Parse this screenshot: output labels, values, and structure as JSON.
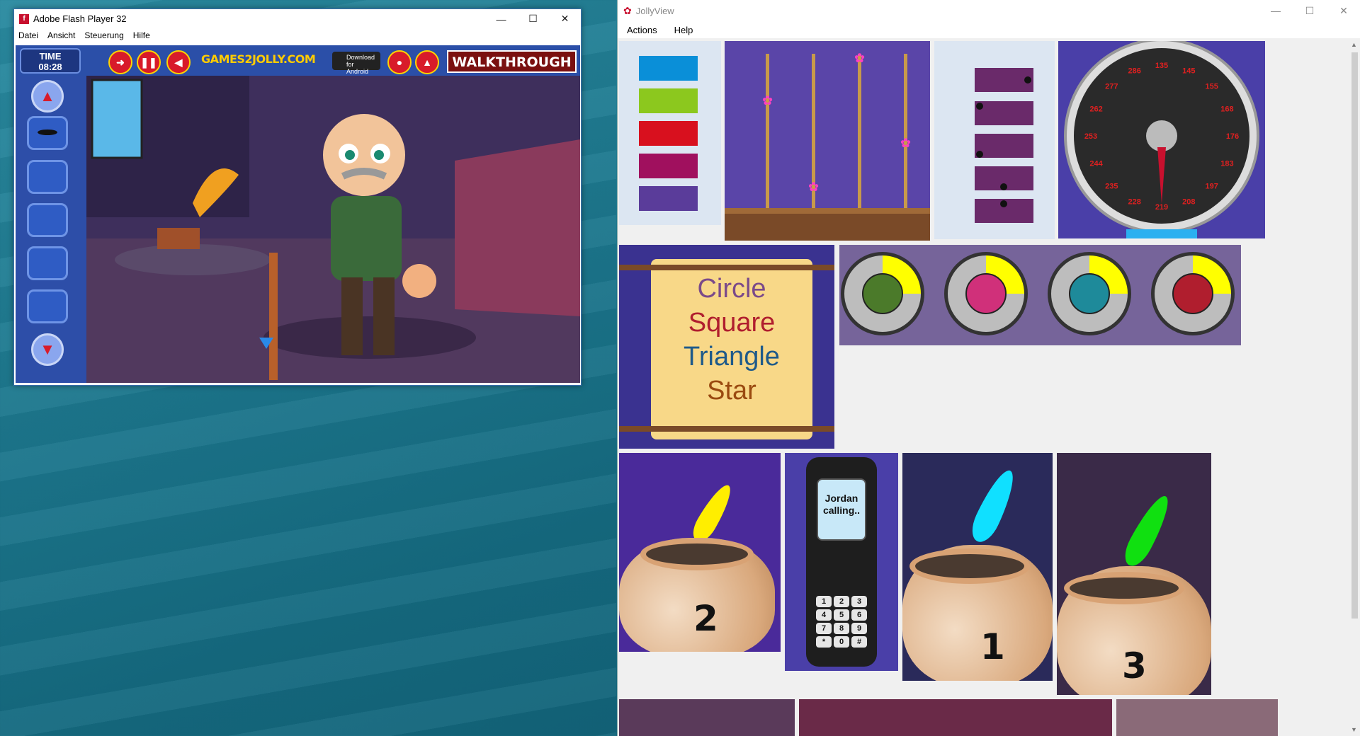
{
  "flash": {
    "title": "Adobe Flash Player 32",
    "menu": [
      "Datei",
      "Ansicht",
      "Steuerung",
      "Hilfe"
    ],
    "game": {
      "time_label": "TIME",
      "time_value": "08:28",
      "logo": "GAMES2JOLLY.COM",
      "android_line1": "Download for",
      "android_line2": "Android",
      "walkthrough": "WALKTHROUGH"
    }
  },
  "jolly": {
    "title": "JollyView",
    "menu": [
      "Actions",
      "Help"
    ],
    "swatches": [
      "#0a8fd8",
      "#8cc81e",
      "#d8101e",
      "#a0105e",
      "#5a3c9a"
    ],
    "speedometer": {
      "ticks": [
        "135",
        "145",
        "155",
        "168",
        "176",
        "183",
        "197",
        "208",
        "219",
        "228",
        "235",
        "244",
        "253",
        "262",
        "277",
        "286"
      ]
    },
    "scroll_words": [
      {
        "text": "Circle",
        "color": "#7b4a8a"
      },
      {
        "text": "Square",
        "color": "#b01e2e"
      },
      {
        "text": "Triangle",
        "color": "#1e5a8a"
      },
      {
        "text": "Star",
        "color": "#9a4a10"
      }
    ],
    "rings": [
      {
        "inner": "#4b7a2a",
        "accent": "#ffff00"
      },
      {
        "inner": "#d0307a",
        "accent": "#ffff00"
      },
      {
        "inner": "#1e8a9a",
        "accent": "#ffff00"
      },
      {
        "inner": "#b01e2e",
        "accent": "#ffff00"
      }
    ],
    "phone_text": "Jordan calling..",
    "phone_keys": [
      "1",
      "2",
      "3",
      "4",
      "5",
      "6",
      "7",
      "8",
      "9",
      "*",
      "0",
      "#"
    ],
    "pots": [
      {
        "number": "2",
        "feather": "#ffee00"
      },
      {
        "number": "1",
        "feather": "#10e0ff"
      },
      {
        "number": "3",
        "feather": "#10e010"
      }
    ]
  }
}
